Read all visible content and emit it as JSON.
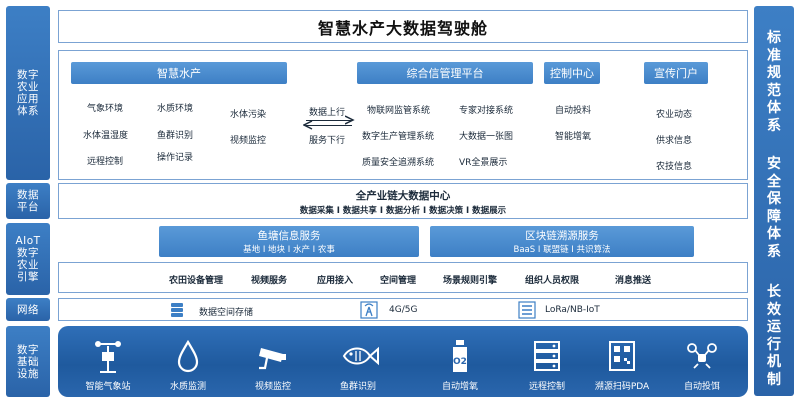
{
  "title": "智慧水产大数据驾驶舱",
  "left_labels": [
    "数字农业应用体系",
    "数据平台",
    "AIoT数字农业引擎",
    "网络",
    "数字基础设施"
  ],
  "right_bar": [
    "标准规范体系",
    "安全保障体系",
    "长效运行机制"
  ],
  "apps": {
    "smart_aqua": {
      "header": "智慧水产",
      "items": [
        "气象环境",
        "水质环境",
        "水体污染",
        "水体温湿度",
        "鱼群识别",
        "视频监控",
        "远程控制",
        "操作记录"
      ]
    },
    "flow": {
      "up": "数据上行",
      "down": "服务下行"
    },
    "info_platform": {
      "header": "综合信管理平台",
      "items": [
        "物联网监管系统",
        "专家对接系统",
        "数字生产管理系统",
        "大数据一张图",
        "质量安全追溯系统",
        "VR全景展示"
      ]
    },
    "control_center": {
      "header": "控制中心",
      "items": [
        "自动投料",
        "智能增氧"
      ]
    },
    "portal": {
      "header": "宣传门户",
      "items": [
        "农业动态",
        "供求信息",
        "农技信息"
      ]
    }
  },
  "data_platform": {
    "title": "全产业链大数据中心",
    "subtitle": "数据采集 I 数据共享 I 数据分析 I 数据决策 I 数据展示"
  },
  "aiot": {
    "fish_service": {
      "title": "鱼塘信息服务",
      "sub": "基地 I 地块 I 水产 I 农事"
    },
    "chain_service": {
      "title": "区块链溯源服务",
      "sub": "BaaS I 联盟链 I 共识算法"
    },
    "engine_items": [
      "农田设备管理",
      "视频服务",
      "应用接入",
      "空间管理",
      "场景规则引擎",
      "组织人员权限",
      "消息推送"
    ]
  },
  "network": [
    {
      "icon": "database-icon",
      "label": "数据空间存储"
    },
    {
      "icon": "signal-tower-icon",
      "label": "4G/5G"
    },
    {
      "icon": "lora-icon",
      "label": "LoRa/NB-IoT"
    }
  ],
  "infrastructure": [
    {
      "icon": "weather-station-icon",
      "label": "智能气象站"
    },
    {
      "icon": "water-drop-icon",
      "label": "水质监测"
    },
    {
      "icon": "cctv-camera-icon",
      "label": "视频监控"
    },
    {
      "icon": "fish-icon",
      "label": "鱼群识别"
    },
    {
      "icon": "oxygen-bottle-icon",
      "label": "自动增氧"
    },
    {
      "icon": "server-icon",
      "label": "远程控制"
    },
    {
      "icon": "qr-code-icon",
      "label": "溯源扫码PDA"
    },
    {
      "icon": "drone-icon",
      "label": "自动投饵"
    }
  ],
  "colors": {
    "primary": "#3d7fc5",
    "dark": "#1f5a9e",
    "border": "#7ba3d3"
  }
}
